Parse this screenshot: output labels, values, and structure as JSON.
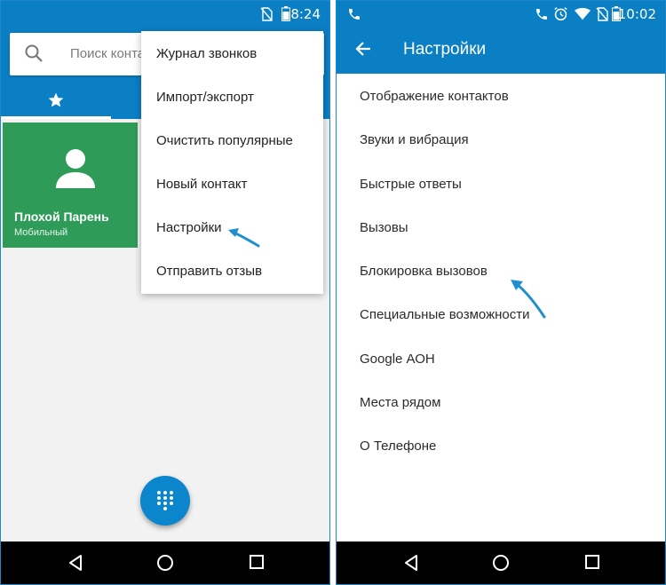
{
  "left_screen": {
    "status_bar": {
      "time": "8:24"
    },
    "search": {
      "placeholder": "Поиск конта"
    },
    "favorite_contact": {
      "name": "Плохой Парень",
      "type": "Мобильный"
    },
    "overflow_menu": {
      "items": [
        {
          "label": "Журнал звонков"
        },
        {
          "label": "Импорт/экспорт"
        },
        {
          "label": "Очистить популярные"
        },
        {
          "label": "Новый контакт"
        },
        {
          "label": "Настройки"
        },
        {
          "label": "Отправить отзыв"
        }
      ]
    }
  },
  "right_screen": {
    "status_bar": {
      "time": "10:02"
    },
    "header": {
      "title": "Настройки"
    },
    "settings": {
      "items": [
        {
          "label": "Отображение контактов"
        },
        {
          "label": "Звуки и вибрация"
        },
        {
          "label": "Быстрые ответы"
        },
        {
          "label": "Вызовы"
        },
        {
          "label": "Блокировка вызовов"
        },
        {
          "label": "Специальные возможности"
        },
        {
          "label": "Google АОН"
        },
        {
          "label": "Места рядом"
        },
        {
          "label": "О Телефоне"
        }
      ]
    }
  },
  "colors": {
    "primary": "#0b7fc4",
    "contact_card": "#2e9b59",
    "annotation_arrow": "#1f8fd0",
    "fab": "#0b85cc"
  },
  "icons": [
    "search-icon",
    "star-icon",
    "person-icon",
    "dialpad-icon",
    "back-arrow-icon",
    "nav-back-icon",
    "nav-home-icon",
    "nav-recents-icon",
    "phone-icon",
    "wifi-icon",
    "battery-icon",
    "alarm-icon",
    "no-sim-icon"
  ]
}
